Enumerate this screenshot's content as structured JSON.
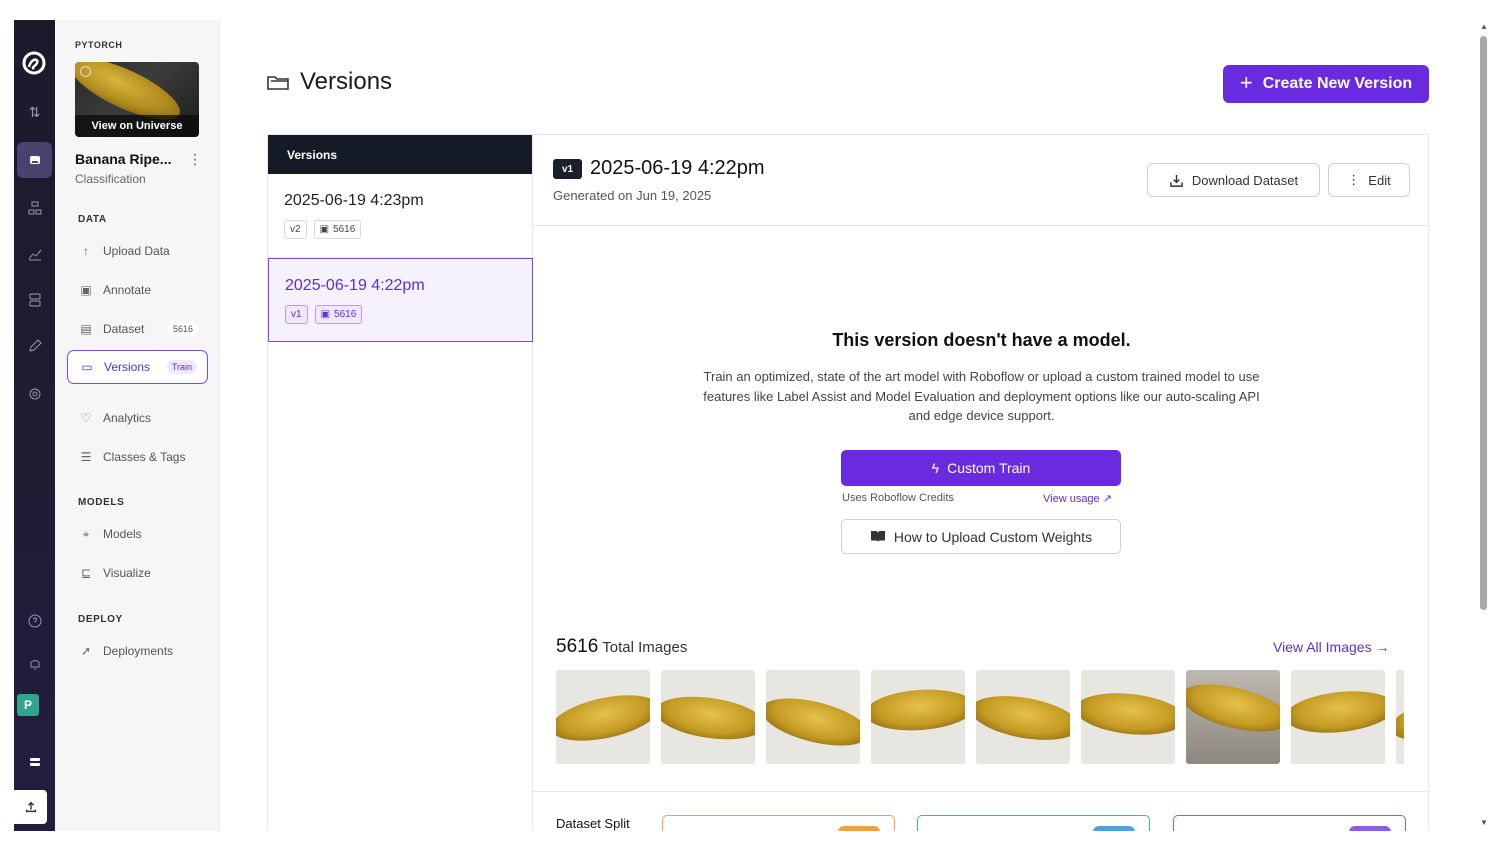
{
  "sidebar": {
    "project_label": "PYTORCH",
    "universe_caption": "View on Universe",
    "project_name": "Banana Ripe...",
    "project_type": "Classification",
    "sections": {
      "data": "DATA",
      "models": "MODELS",
      "deploy": "DEPLOY"
    },
    "items": [
      {
        "label": "Upload Data",
        "icon": "upload-icon"
      },
      {
        "label": "Annotate",
        "icon": "annotate-icon"
      },
      {
        "label": "Dataset",
        "icon": "dataset-icon",
        "count": "5616"
      },
      {
        "label": "Versions",
        "icon": "versions-icon",
        "pill": "Train"
      },
      {
        "label": "Analytics",
        "icon": "analytics-icon"
      },
      {
        "label": "Classes & Tags",
        "icon": "classes-icon"
      },
      {
        "label": "Models",
        "icon": "models-icon"
      },
      {
        "label": "Visualize",
        "icon": "visualize-icon"
      },
      {
        "label": "Deployments",
        "icon": "rocket-icon"
      }
    ]
  },
  "rail": {
    "avatar": "P"
  },
  "header": {
    "title": "Versions",
    "create_label": "Create New Version"
  },
  "versions": {
    "heading": "Versions",
    "items": [
      {
        "date": "2025-06-19 4:23pm",
        "tag": "v2",
        "images": "5616"
      },
      {
        "date": "2025-06-19 4:22pm",
        "tag": "v1",
        "images": "5616"
      }
    ]
  },
  "detail": {
    "badge": "v1",
    "title": "2025-06-19 4:22pm",
    "subtitle": "Generated on Jun 19, 2025",
    "download_label": "Download Dataset",
    "edit_label": "Edit",
    "no_model_title": "This version doesn't have a model.",
    "no_model_text": "Train an optimized, state of the art model with Roboflow or upload a custom trained model to use features like Label Assist and Model Evaluation and deployment options like our auto-scaling API and edge device support.",
    "custom_train_label": "Custom Train",
    "credits_text": "Uses Roboflow Credits",
    "view_usage_label": "View usage ↗",
    "howto_label": "How to Upload Custom Weights",
    "total_images": "5616",
    "total_images_label": "Total Images",
    "view_all_label": "View All Images →",
    "split_label": "Dataset Split"
  },
  "colors": {
    "accent": "#6a2be0",
    "rail": "#1b1a2b",
    "train_split": "#f0a040",
    "valid_split": "#4aa3e0",
    "test_split": "#8a5ce8"
  }
}
